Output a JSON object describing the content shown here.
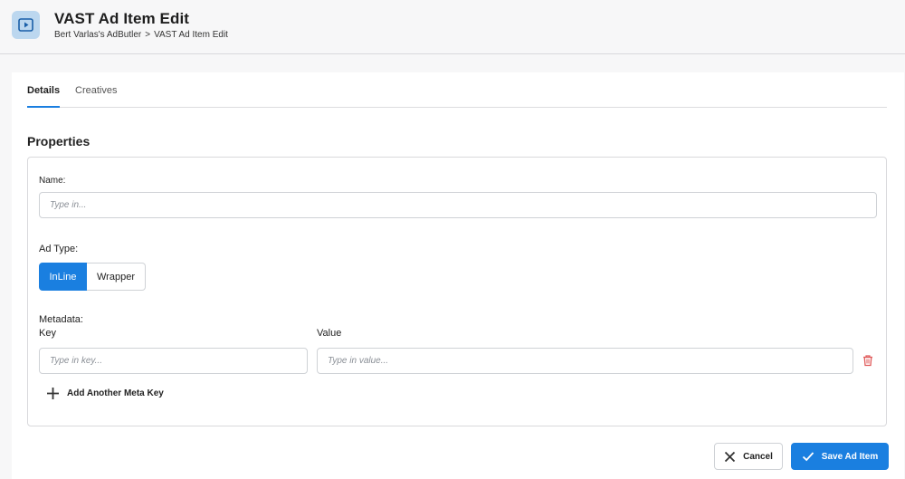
{
  "header": {
    "icon": "video-play-icon",
    "title": "VAST Ad Item Edit",
    "breadcrumb": [
      "Bert Varlas's AdButler",
      "VAST Ad Item Edit"
    ],
    "breadcrumb_separator": ">"
  },
  "tabs": [
    {
      "label": "Details",
      "active": true
    },
    {
      "label": "Creatives",
      "active": false
    }
  ],
  "properties": {
    "title": "Properties",
    "name_label": "Name:",
    "name_placeholder": "Type in...",
    "name_value": "",
    "ad_type_label": "Ad Type:",
    "ad_type_options": [
      "InLine",
      "Wrapper"
    ],
    "ad_type_selected": "InLine",
    "metadata_label": "Metadata:",
    "key_label": "Key",
    "value_label": "Value",
    "key_placeholder": "Type in key...",
    "value_placeholder": "Type in value...",
    "add_meta_label": "Add Another Meta Key"
  },
  "actions": {
    "cancel_label": "Cancel",
    "save_label": "Save Ad Item"
  },
  "colors": {
    "accent": "#1a7fe0",
    "icon_bg": "#bcd7ef",
    "delete": "#e05a5a"
  }
}
